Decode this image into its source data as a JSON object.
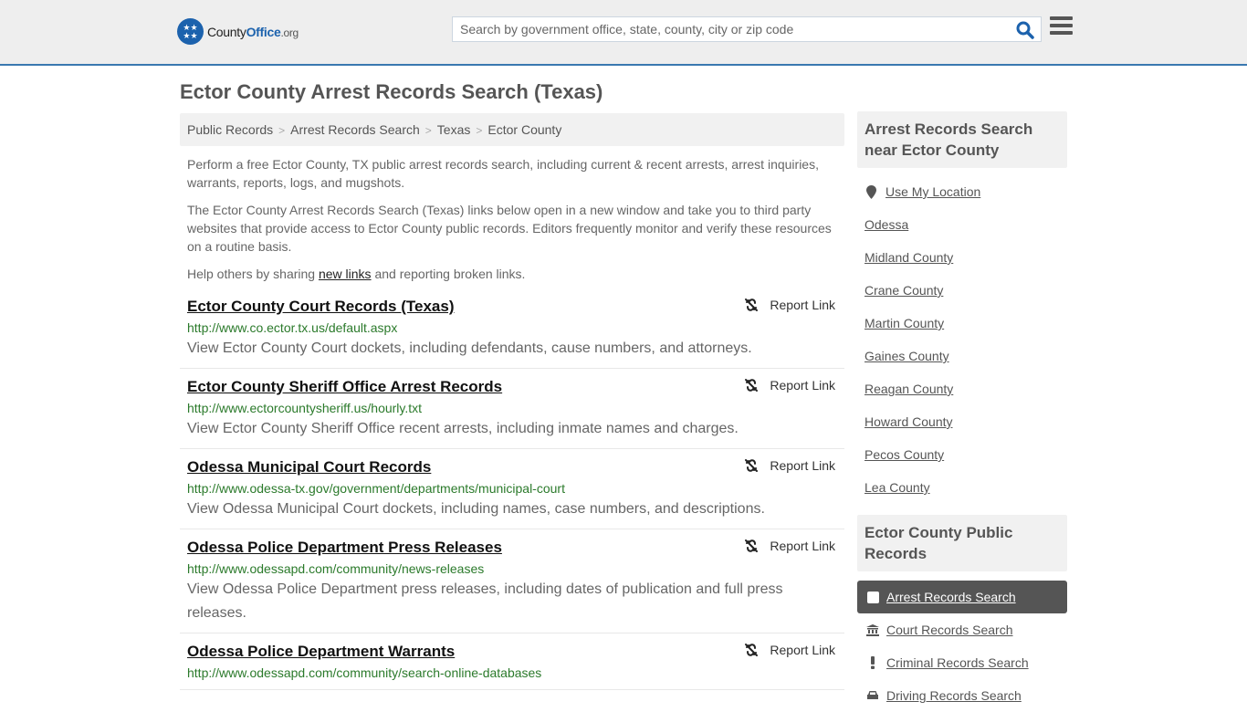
{
  "header": {
    "logo": {
      "prefix": "County",
      "brand": "Office",
      "tld": ".org"
    },
    "search_placeholder": "Search by government office, state, county, city or zip code",
    "search_value": ""
  },
  "page_title": "Ector County Arrest Records Search (Texas)",
  "breadcrumb": [
    {
      "label": "Public Records"
    },
    {
      "label": "Arrest Records Search"
    },
    {
      "label": "Texas"
    },
    {
      "label": "Ector County"
    }
  ],
  "breadcrumb_sep": ">",
  "intro": {
    "p1": "Perform a free Ector County, TX public arrest records search, including current & recent arrests, arrest inquiries, warrants, reports, logs, and mugshots.",
    "p2": "The Ector County Arrest Records Search (Texas) links below open in a new window and take you to third party websites that provide access to Ector County public records. Editors frequently monitor and verify these resources on a routine basis.",
    "p3_before": "Help others by sharing ",
    "p3_link": "new links",
    "p3_after": " and reporting broken links."
  },
  "report_label": "Report Link",
  "listings": [
    {
      "title": "Ector County Court Records (Texas)",
      "url": "http://www.co.ector.tx.us/default.aspx",
      "desc": "View Ector County Court dockets, including defendants, cause numbers, and attorneys."
    },
    {
      "title": "Ector County Sheriff Office Arrest Records",
      "url": "http://www.ectorcountysheriff.us/hourly.txt",
      "desc": "View Ector County Sheriff Office recent arrests, including inmate names and charges."
    },
    {
      "title": "Odessa Municipal Court Records",
      "url": "http://www.odessa-tx.gov/government/departments/municipal-court",
      "desc": "View Odessa Municipal Court dockets, including names, case numbers, and descriptions."
    },
    {
      "title": "Odessa Police Department Press Releases",
      "url": "http://www.odessapd.com/community/news-releases",
      "desc": "View Odessa Police Department press releases, including dates of publication and full press releases."
    },
    {
      "title": "Odessa Police Department Warrants",
      "url": "http://www.odessapd.com/community/search-online-databases",
      "desc": ""
    }
  ],
  "sidebar": {
    "nearby_heading": "Arrest Records Search near Ector County",
    "use_location": "Use My Location",
    "nearby": [
      "Odessa",
      "Midland County",
      "Crane County",
      "Martin County",
      "Gaines County",
      "Reagan County",
      "Howard County",
      "Pecos County",
      "Lea County"
    ],
    "records_heading": "Ector County Public Records",
    "records": [
      {
        "label": "Arrest Records Search",
        "icon": "square-icon",
        "active": true
      },
      {
        "label": "Court Records Search",
        "icon": "courthouse-icon",
        "active": false
      },
      {
        "label": "Criminal Records Search",
        "icon": "exclamation-icon",
        "active": false
      },
      {
        "label": "Driving Records Search",
        "icon": "car-icon",
        "active": false
      }
    ]
  },
  "colors": {
    "accent": "#3a78b0",
    "brand": "#1c62ad",
    "url_green": "#2b7a2b",
    "active_bg": "#555555"
  }
}
